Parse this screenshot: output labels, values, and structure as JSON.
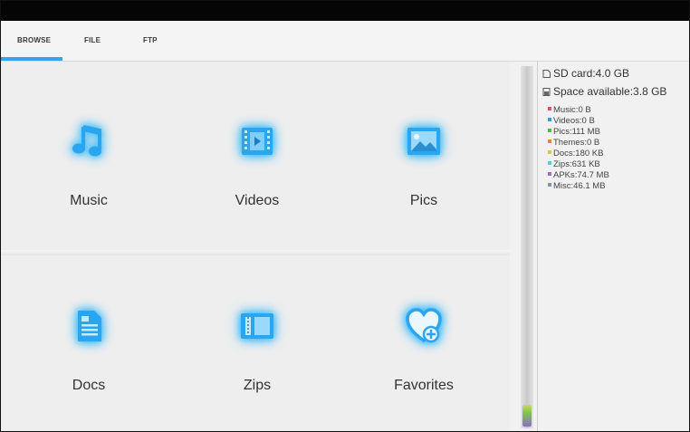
{
  "tabs": [
    {
      "label": "BROWSE"
    },
    {
      "label": "FILE"
    },
    {
      "label": "FTP"
    }
  ],
  "active_tab": "BROWSE",
  "accent_color": "#35a5e5",
  "categories": {
    "music": "Music",
    "videos": "Videos",
    "pics": "Pics",
    "docs": "Docs",
    "zips": "Zips",
    "favorites": "Favorites"
  },
  "storage": {
    "sd_card": "SD card:4.0 GB",
    "space_available": "Space available:3.8 GB",
    "breakdown": [
      {
        "label": "Music:0 B",
        "color": "#e0506a"
      },
      {
        "label": "Videos:0 B",
        "color": "#3a9ad9"
      },
      {
        "label": "Pics:111 MB",
        "color": "#5ab84a"
      },
      {
        "label": "Themes:0 B",
        "color": "#e08a2a"
      },
      {
        "label": "Docs:180 KB",
        "color": "#d8c850"
      },
      {
        "label": "Zips:631 KB",
        "color": "#60c8d8"
      },
      {
        "label": "APKs:74.7 MB",
        "color": "#9a6ad8"
      },
      {
        "label": "Misc:46.1 MB",
        "color": "#8890a0"
      }
    ]
  }
}
